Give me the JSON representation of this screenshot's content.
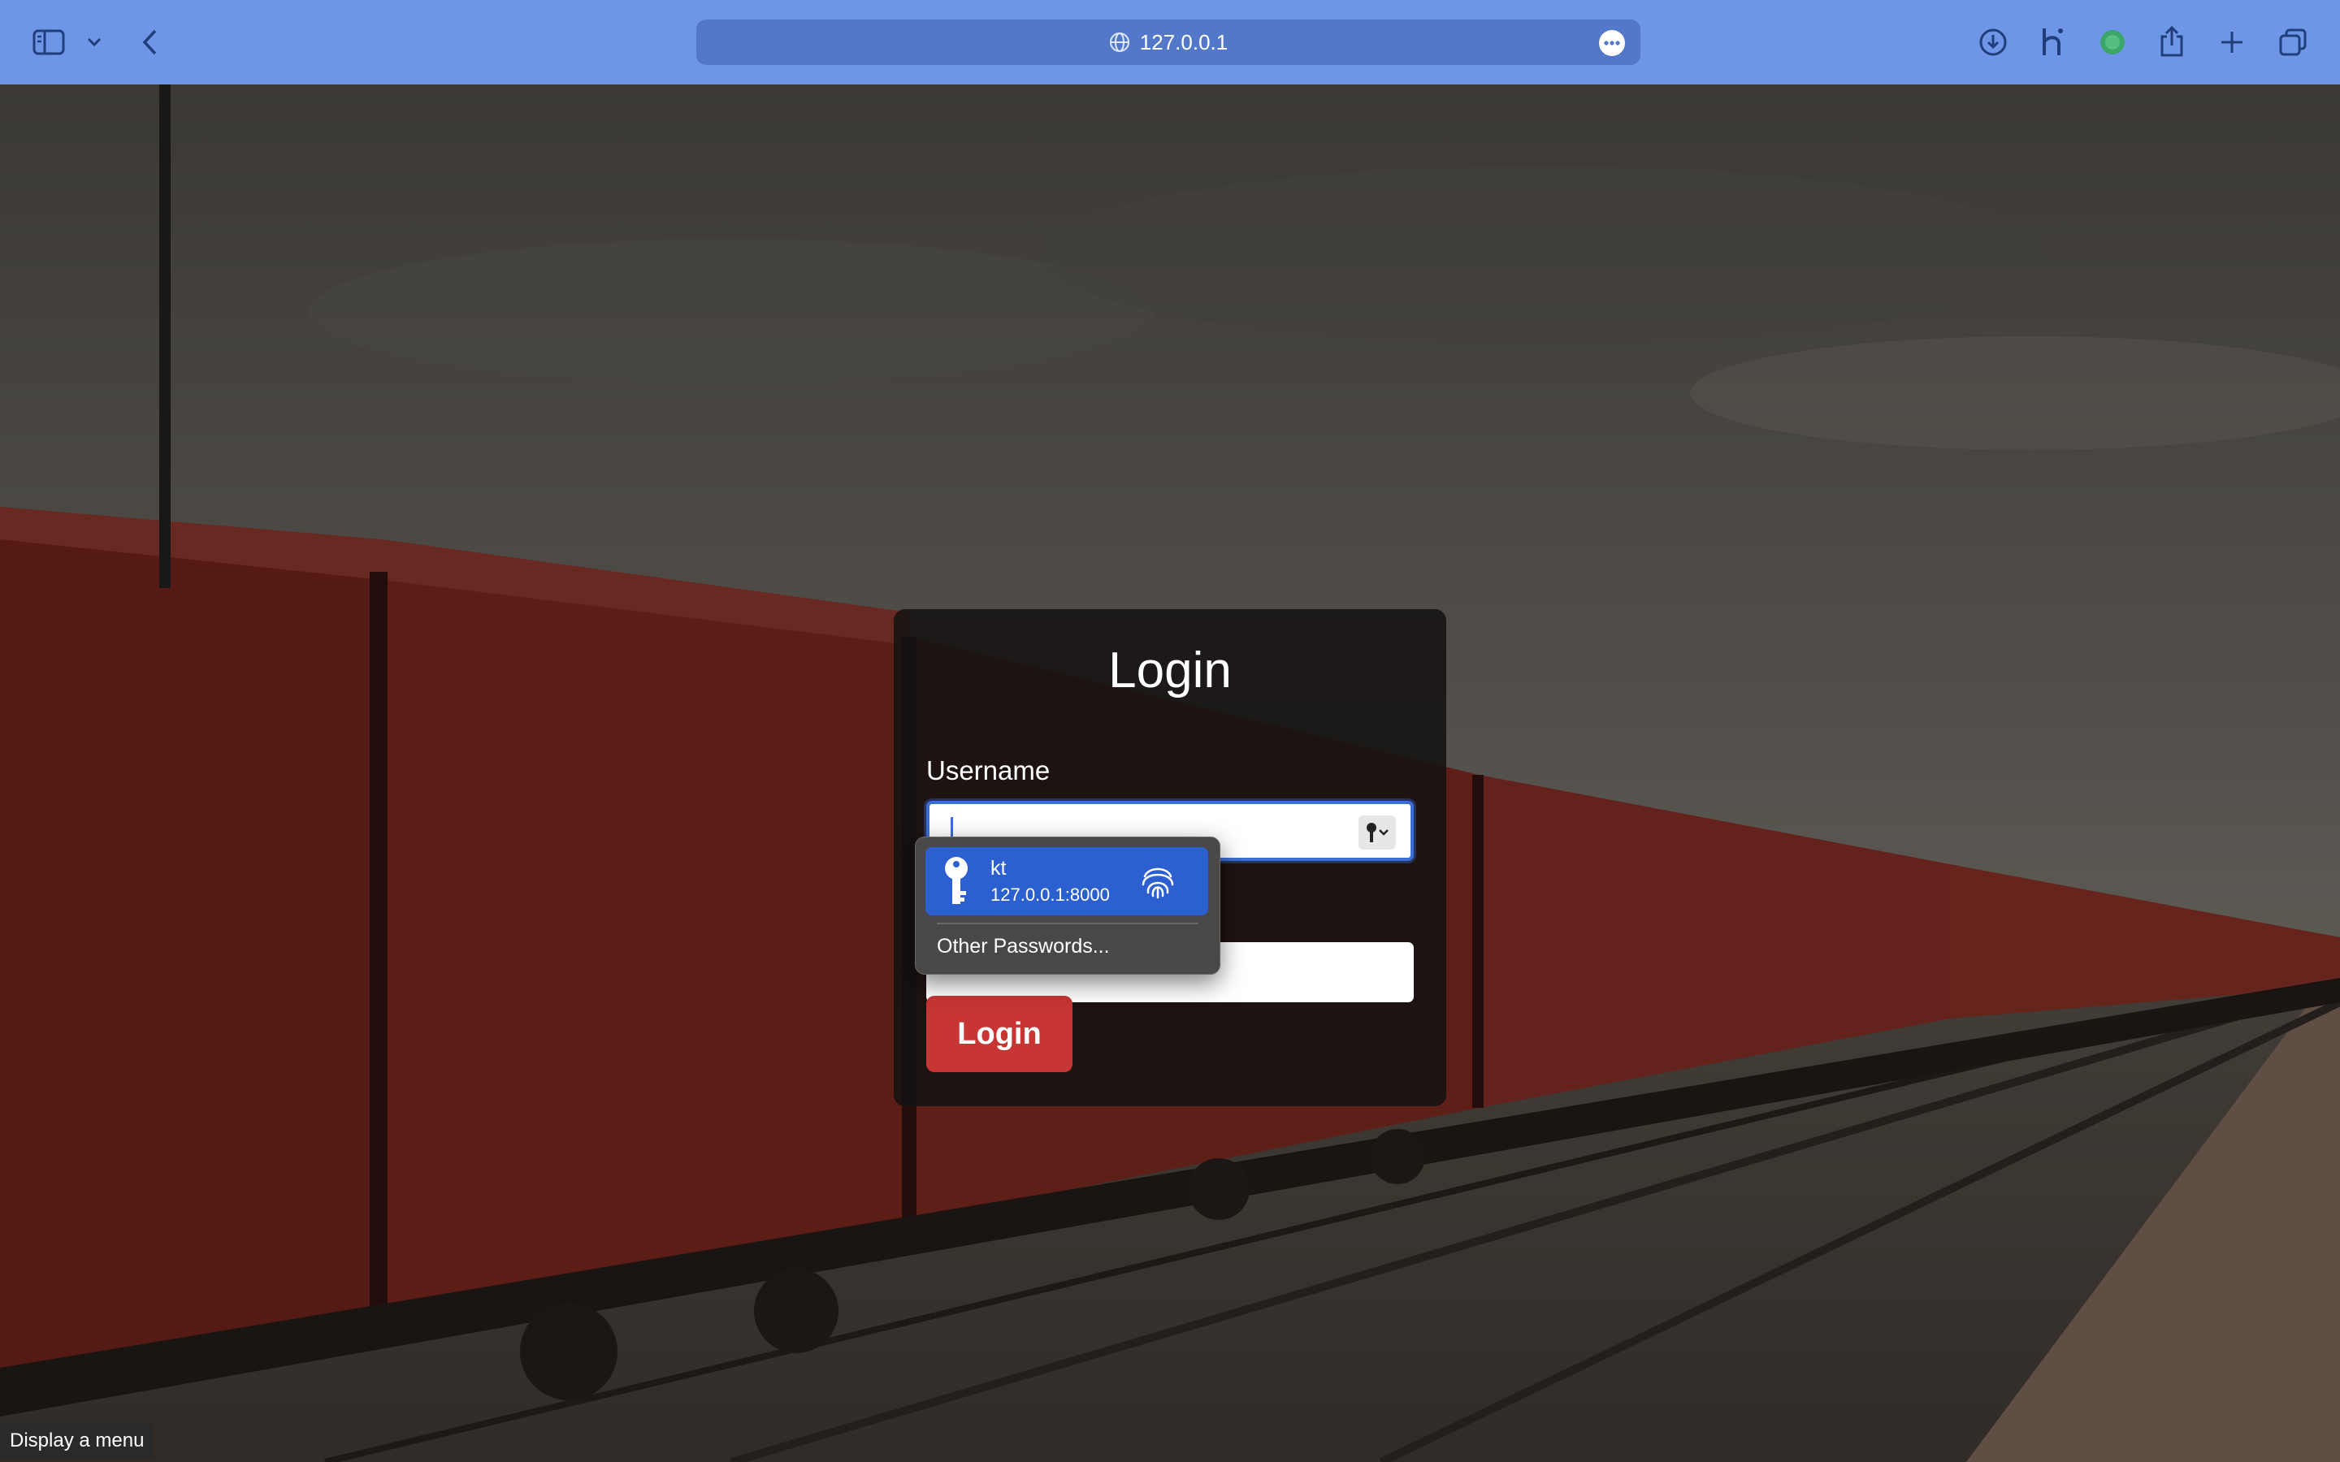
{
  "browser": {
    "url": "127.0.0.1",
    "accent": "#6f96e6"
  },
  "login": {
    "title": "Login",
    "username_label": "Username",
    "username_value": "",
    "password_value": "",
    "submit_label": "Login",
    "button_color": "#c73535"
  },
  "autofill": {
    "username": "kt",
    "host": "127.0.0.1:8000",
    "other_label": "Other Passwords..."
  },
  "status_text": "Display a menu"
}
